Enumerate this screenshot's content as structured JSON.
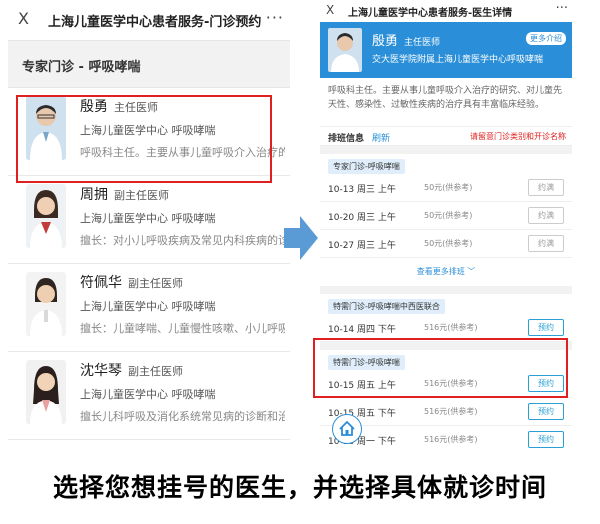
{
  "left": {
    "close_glyph": "X",
    "title": "上海儿童医学中心患者服务-门诊预约",
    "more_glyph": "···",
    "section_title": "专家门诊 - 呼吸哮喘",
    "doctors": [
      {
        "name": "殷勇",
        "title": "主任医师",
        "hospital": "上海儿童医学中心 呼吸哮喘",
        "desc": "呼吸科主任。主要从事儿童呼吸介入治疗的研"
      },
      {
        "name": "周拥",
        "title": "副主任医师",
        "hospital": "上海儿童医学中心 呼吸哮喘",
        "desc": "擅长：对小儿呼吸疾病及常见内科疾病的诊治有"
      },
      {
        "name": "符佩华",
        "title": "副主任医师",
        "hospital": "上海儿童医学中心 呼吸哮喘",
        "desc": "擅长：儿童哮喘、儿童慢性咳嗽、小儿呼吸系统"
      },
      {
        "name": "沈华琴",
        "title": "副主任医师",
        "hospital": "上海儿童医学中心 呼吸哮喘",
        "desc": "擅长儿科呼吸及消化系统常见病的诊断和治疗有"
      }
    ]
  },
  "right": {
    "close_glyph": "X",
    "title": "上海儿童医学中心患者服务-医生详情",
    "more_glyph": "···",
    "doctor_name": "殷勇",
    "doctor_title": "主任医师",
    "doctor_hospital": "交大医学院附属上海儿童医学中心呼吸哮喘",
    "intro_button": "更多介绍",
    "description": "呼吸科主任。主要从事儿童呼吸介入治疗的研究、对儿童先天性、感染性、过敏性疾病的治疗具有丰富临床经验。",
    "schedule_label": "排班信息",
    "refresh_label": "刷新",
    "notice": "请留意门诊类别和开诊名称",
    "section1_label": "专家门诊-呼吸哮喘",
    "rows1": [
      {
        "date": "10-13 周三 上午",
        "price": "50元(供参考)",
        "button": "约满"
      },
      {
        "date": "10-20 周三 上午",
        "price": "50元(供参考)",
        "button": "约满"
      },
      {
        "date": "10-27 周三 上午",
        "price": "50元(供参考)",
        "button": "约满"
      }
    ],
    "see_more": "查看更多排班 ﹀",
    "section2_label": "特需门诊-呼吸哮喘中西医联合",
    "rows2": [
      {
        "date": "10-14 周四 下午",
        "price": "516元(供参考)",
        "button": "预约"
      }
    ],
    "section3_label": "特需门诊-呼吸哮喘",
    "rows3": [
      {
        "date": "10-15 周五 上午",
        "price": "516元(供参考)",
        "button": "预约"
      },
      {
        "date": "10-15 周五 下午",
        "price": "516元(供参考)",
        "button": "预约"
      },
      {
        "date": "10-18 周一 下午",
        "price": "516元(供参考)",
        "button": "预约"
      }
    ]
  },
  "caption": "选择您想挂号的医生，并选择具体就诊时间",
  "colors": {
    "accent_blue": "#2a8fd8",
    "highlight_red": "#e02020",
    "arrow_blue": "#5b9bd5"
  }
}
